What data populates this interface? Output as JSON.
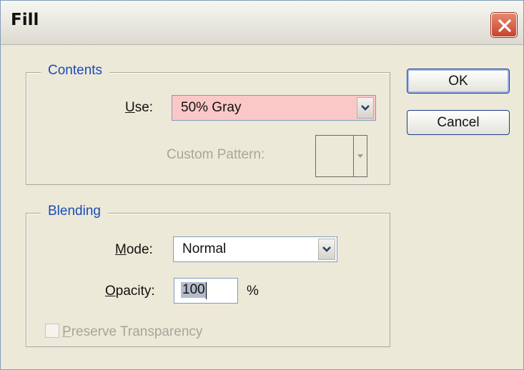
{
  "window": {
    "title": "Fill"
  },
  "buttons": {
    "ok": "OK",
    "cancel": "Cancel"
  },
  "contents": {
    "legend": "Contents",
    "use_label_accel": "U",
    "use_label_rest": "se:",
    "use_value": "50% Gray",
    "custom_pattern_label": "Custom Pattern:"
  },
  "blending": {
    "legend": "Blending",
    "mode_label_accel": "M",
    "mode_label_rest": "ode:",
    "mode_value": "Normal",
    "opacity_label_accel": "O",
    "opacity_label_rest": "pacity:",
    "opacity_value": "100",
    "opacity_unit": "%",
    "preserve_accel": "P",
    "preserve_rest": "reserve Transparency",
    "preserve_checked": false
  },
  "colors": {
    "use_highlight": "#fbc8c8",
    "legend_text": "#1c4bb8",
    "close_button": "#c8432a"
  },
  "icons": {
    "close": "close-x-icon",
    "dropdown": "chevron-down-icon"
  }
}
